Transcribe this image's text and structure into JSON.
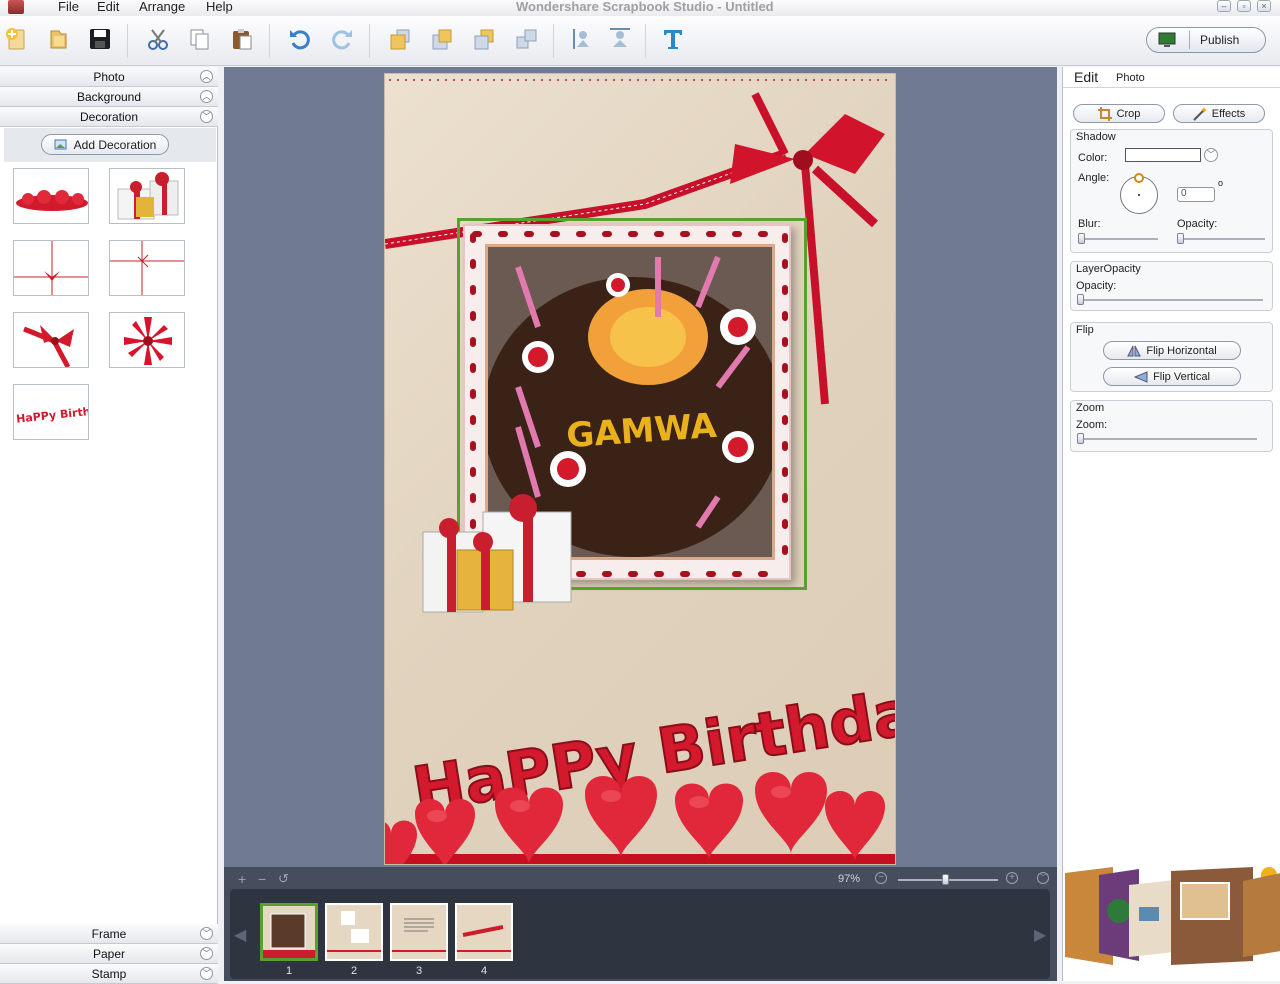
{
  "titlebar": {
    "title": "Wondershare Scrapbook Studio - Untitled",
    "menu": [
      "File",
      "Edit",
      "Arrange",
      "Help"
    ]
  },
  "toolbar": {
    "publish_label": "Publish"
  },
  "left_panel": {
    "sections_top": [
      "Photo",
      "Background",
      "Decoration"
    ],
    "add_decoration_label": "Add Decoration",
    "sections_bottom": [
      "Frame",
      "Paper",
      "Stamp"
    ]
  },
  "canvas": {
    "cake_text": "GAMWA",
    "wordart_text": "HaPPy Birthday",
    "zoom_text": "97%"
  },
  "pages": [
    "1",
    "2",
    "3",
    "4"
  ],
  "right_panel": {
    "tabs": [
      "Edit",
      "Photo"
    ],
    "crop_label": "Crop",
    "effects_label": "Effects",
    "shadow": {
      "title": "Shadow",
      "color_label": "Color:",
      "angle_label": "Angle:",
      "angle_value": "0",
      "degree_sign": "o",
      "blur_label": "Blur:",
      "opacity_label": "Opacity:"
    },
    "layer_opacity": {
      "title": "LayerOpacity",
      "opacity_label": "Opacity:"
    },
    "flip": {
      "title": "Flip",
      "horizontal_label": "Flip Horizontal",
      "vertical_label": "Flip Vertical"
    },
    "zoom": {
      "title": "Zoom",
      "zoom_label": "Zoom:"
    }
  },
  "colors": {
    "canvas_bg": "#707a92",
    "selection": "#5aa02c",
    "accent_red": "#d0102a"
  }
}
